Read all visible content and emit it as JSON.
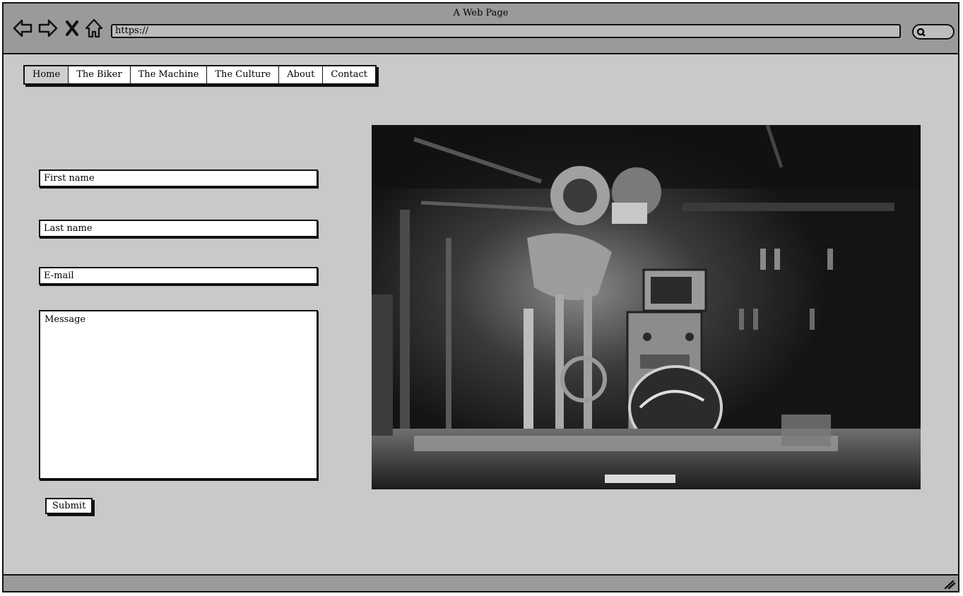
{
  "window": {
    "title": "A Web Page"
  },
  "browser": {
    "url": "https://",
    "icons": [
      "back-arrow-icon",
      "forward-arrow-icon",
      "close-x-icon",
      "home-icon",
      "search-icon"
    ]
  },
  "nav": {
    "items": [
      {
        "label": "Home",
        "active": true
      },
      {
        "label": "The Biker",
        "active": false
      },
      {
        "label": "The Machine",
        "active": false
      },
      {
        "label": "The Culture",
        "active": false
      },
      {
        "label": "About",
        "active": false
      },
      {
        "label": "Contact",
        "active": false
      }
    ]
  },
  "form": {
    "first_name_placeholder": "First name",
    "last_name_placeholder": "Last name",
    "email_placeholder": "E-mail",
    "message_placeholder": "Message",
    "submit_label": "Submit"
  },
  "colors": {
    "window_bg": "#c9c9c9",
    "chrome_bg": "#9a9a9a",
    "outline": "#111111"
  }
}
